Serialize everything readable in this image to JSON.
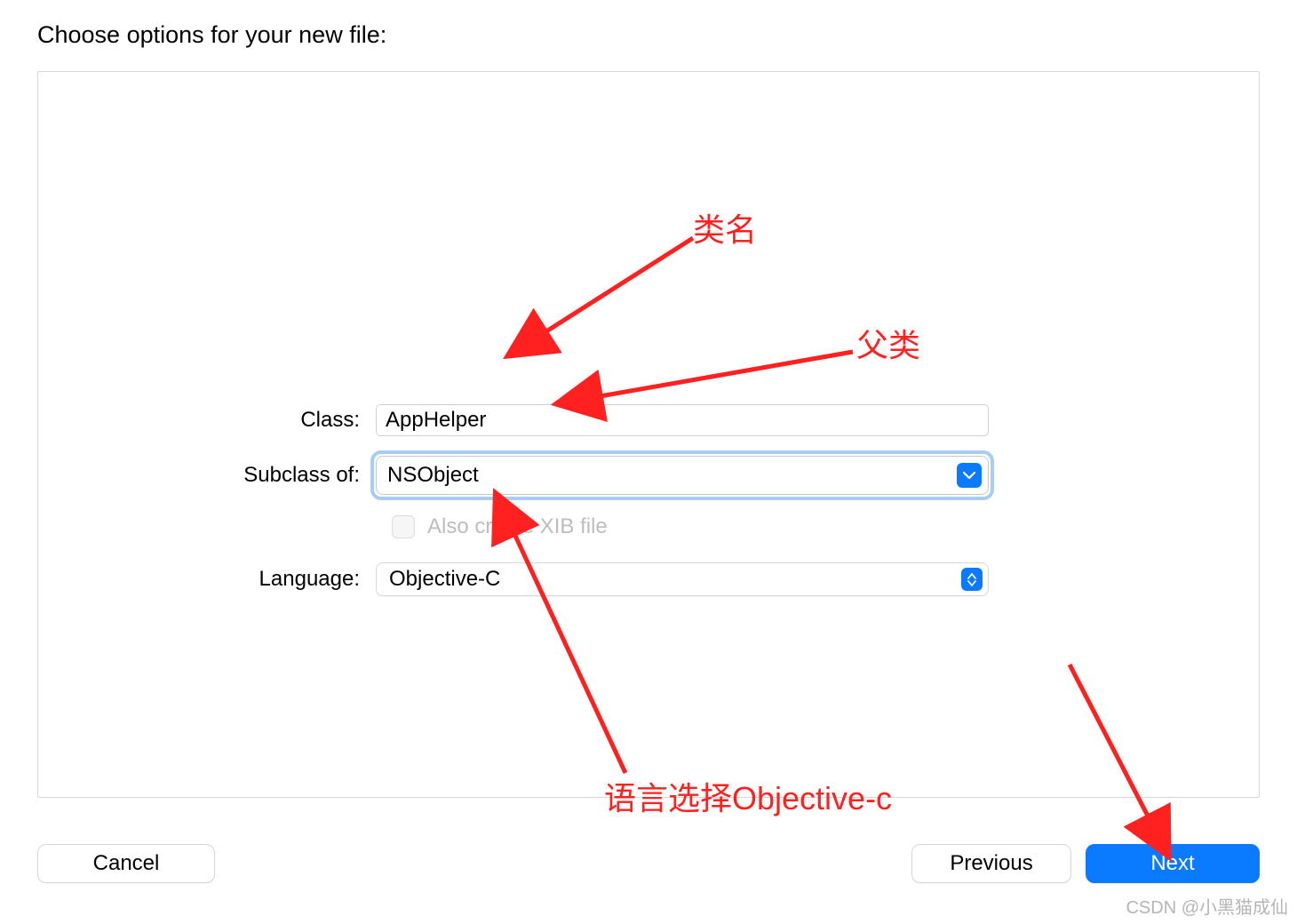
{
  "header": {
    "title": "Choose options for your new file:"
  },
  "form": {
    "class_label": "Class:",
    "class_value": "AppHelper",
    "subclass_label": "Subclass of:",
    "subclass_value": "NSObject",
    "xib_label": "Also create XIB file",
    "language_label": "Language:",
    "language_value": "Objective-C"
  },
  "buttons": {
    "cancel": "Cancel",
    "previous": "Previous",
    "next": "Next"
  },
  "annotations": {
    "class_name": "类名",
    "parent_class": "父类",
    "language_hint": "语言选择Objective-c"
  },
  "annotation_color": "#ff2020",
  "watermark": "CSDN @小黑猫成仙"
}
